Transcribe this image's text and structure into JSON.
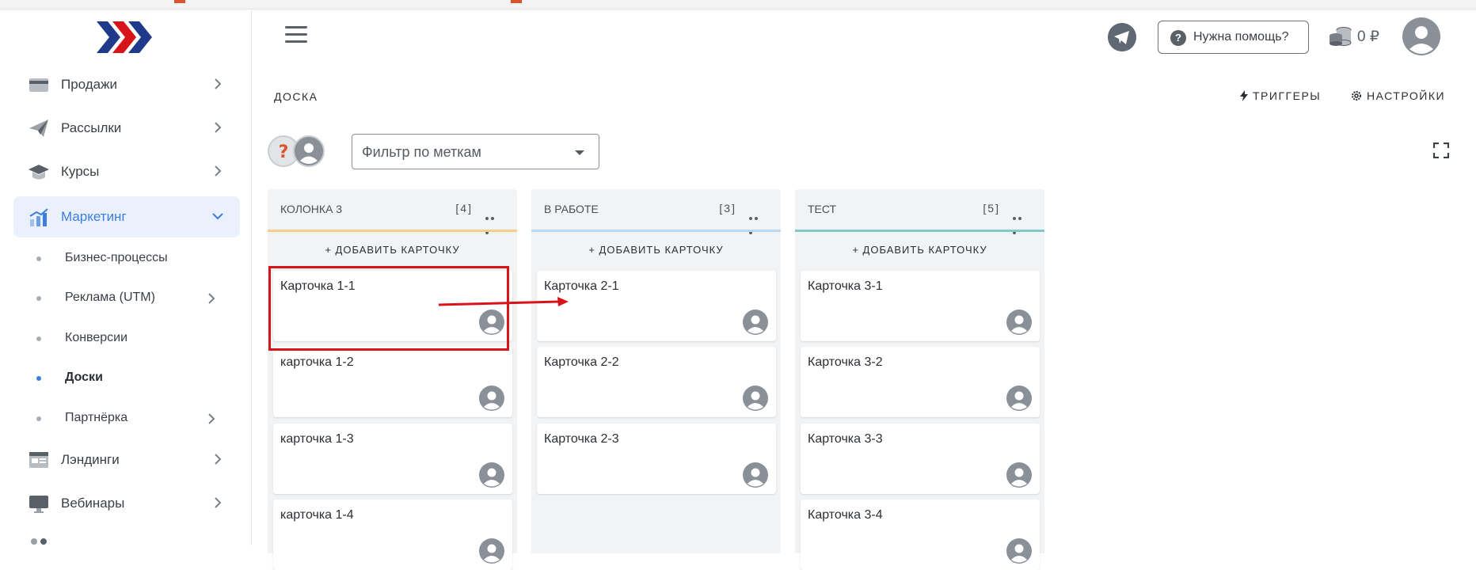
{
  "sidebar": {
    "logo": "logo-chevrons",
    "items": [
      {
        "label": "Продажи",
        "icon": "card-icon"
      },
      {
        "label": "Рассылки",
        "icon": "send-icon"
      },
      {
        "label": "Курсы",
        "icon": "graduation-cap-icon"
      },
      {
        "label": "Маркетинг",
        "icon": "chart-up-icon",
        "active": true
      },
      {
        "label": "Лэндинги",
        "icon": "landing-page-icon"
      },
      {
        "label": "Вебинары",
        "icon": "monitor-icon"
      }
    ],
    "subitems": [
      {
        "label": "Бизнес-процессы"
      },
      {
        "label": "Реклама (UTM)"
      },
      {
        "label": "Конверсии"
      },
      {
        "label": "Доски",
        "current": true
      },
      {
        "label": "Партнёрка"
      }
    ]
  },
  "header": {
    "help_label": "Нужна помощь?",
    "balance": "0 ₽"
  },
  "page": {
    "title": "ДОСКА",
    "triggers_label": "ТРИГГЕРЫ",
    "settings_label": "НАСТРОЙКИ",
    "filter_placeholder": "Фильтр по меткам"
  },
  "columns": [
    {
      "title": "КОЛОНКА 3",
      "count": "[4]",
      "color": "#f5cf8a",
      "add_label": "+ ДОБАВИТЬ КАРТОЧКУ",
      "cards": [
        "Карточка 1-1",
        "карточка 1-2",
        "карточка 1-3",
        "карточка 1-4"
      ]
    },
    {
      "title": "В РАБОТЕ",
      "count": "[3]",
      "color": "#b9d8f2",
      "add_label": "+ ДОБАВИТЬ КАРТОЧКУ",
      "cards": [
        "Карточка 2-1",
        "Карточка 2-2",
        "Карточка 2-3"
      ]
    },
    {
      "title": "ТЕСТ",
      "count": "[5]",
      "color": "#7fcac6",
      "add_label": "+ ДОБАВИТЬ КАРТОЧКУ",
      "cards": [
        "Карточка 3-1",
        "Карточка 3-2",
        "Карточка 3-3",
        "Карточка 3-4"
      ]
    }
  ],
  "colors": {
    "accent": "#3d7de0",
    "annotation": "#d9131a"
  }
}
